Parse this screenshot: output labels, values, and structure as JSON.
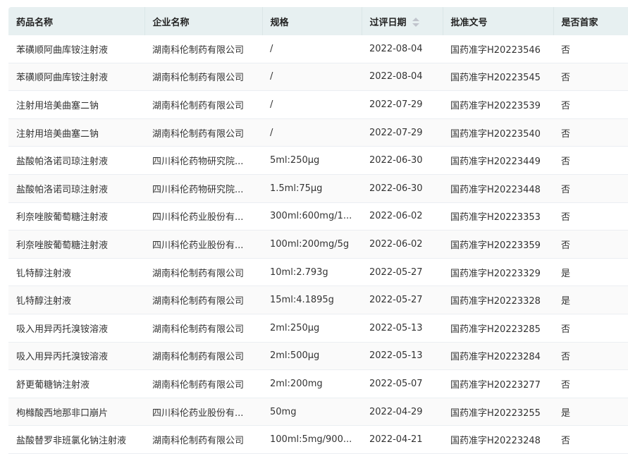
{
  "columns": [
    "药品名称",
    "企业名称",
    "规格",
    "过评日期",
    "批准文号",
    "是否首家"
  ],
  "rows": [
    [
      "苯磺顺阿曲库铵注射液",
      "湖南科伦制药有限公司",
      "/",
      "2022-08-04",
      "国药准字H20223546",
      "否"
    ],
    [
      "苯磺顺阿曲库铵注射液",
      "湖南科伦制药有限公司",
      "/",
      "2022-08-04",
      "国药准字H20223545",
      "否"
    ],
    [
      "注射用培美曲塞二钠",
      "湖南科伦制药有限公司",
      "/",
      "2022-07-29",
      "国药准字H20223539",
      "否"
    ],
    [
      "注射用培美曲塞二钠",
      "湖南科伦制药有限公司",
      "/",
      "2022-07-29",
      "国药准字H20223540",
      "否"
    ],
    [
      "盐酸帕洛诺司琼注射液",
      "四川科伦药物研究院...",
      "5ml:250μg",
      "2022-06-30",
      "国药准字H20223449",
      "否"
    ],
    [
      "盐酸帕洛诺司琼注射液",
      "四川科伦药物研究院...",
      "1.5ml:75μg",
      "2022-06-30",
      "国药准字H20223448",
      "否"
    ],
    [
      "利奈唑胺葡萄糖注射液",
      "四川科伦药业股份有...",
      "300ml:600mg/1...",
      "2022-06-02",
      "国药准字H20223353",
      "否"
    ],
    [
      "利奈唑胺葡萄糖注射液",
      "四川科伦药业股份有...",
      "100ml:200mg/5g",
      "2022-06-02",
      "国药准字H20223359",
      "否"
    ],
    [
      "钆特醇注射液",
      "湖南科伦制药有限公司",
      "10ml:2.793g",
      "2022-05-27",
      "国药准字H20223329",
      "是"
    ],
    [
      "钆特醇注射液",
      "湖南科伦制药有限公司",
      "15ml:4.1895g",
      "2022-05-27",
      "国药准字H20223328",
      "是"
    ],
    [
      "吸入用异丙托溴铵溶液",
      "湖南科伦制药有限公司",
      "2ml:250μg",
      "2022-05-13",
      "国药准字H20223285",
      "否"
    ],
    [
      "吸入用异丙托溴铵溶液",
      "湖南科伦制药有限公司",
      "2ml:500μg",
      "2022-05-13",
      "国药准字H20223284",
      "否"
    ],
    [
      "舒更葡糖钠注射液",
      "湖南科伦制药有限公司",
      "2ml:200mg",
      "2022-05-07",
      "国药准字H20223277",
      "否"
    ],
    [
      "枸橼酸西地那非口崩片",
      "四川科伦药业股份有...",
      "50mg",
      "2022-04-29",
      "国药准字H20223255",
      "是"
    ],
    [
      "盐酸替罗非班氯化钠注射液",
      "湖南科伦制药有限公司",
      "100ml:5mg/900...",
      "2022-04-21",
      "国药准字H20223248",
      "否"
    ]
  ]
}
